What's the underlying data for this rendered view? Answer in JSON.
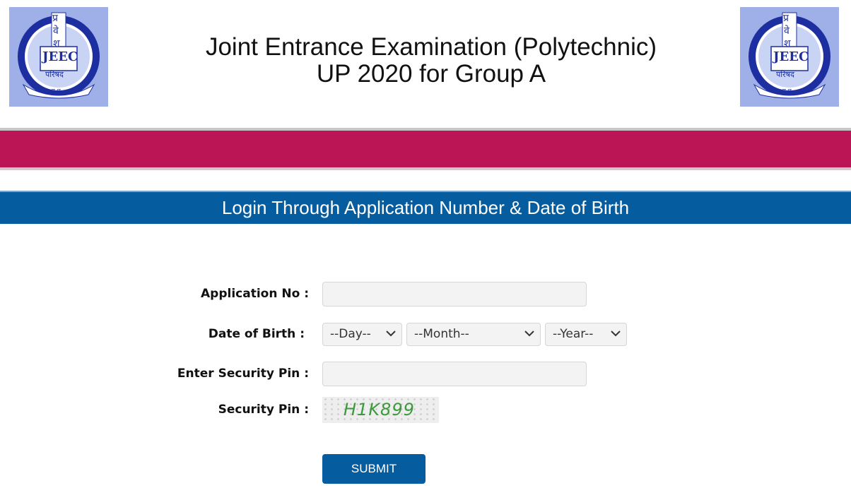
{
  "header": {
    "title_line1": "Joint Entrance Examination (Polytechnic)",
    "title_line2": "UP 2020 for Group A",
    "logo_text": "JEEC",
    "logo_hindi_top": "प्र",
    "logo_hindi_mid": "वे",
    "logo_hindi_bot": "श",
    "logo_hindi_parishad": "परिषद",
    "logo_hindi_up": "उ.प्र.",
    "colors": {
      "accent_band": "#bc1556",
      "bar": "#055d9f"
    }
  },
  "login": {
    "title": "Login Through Application Number & Date of Birth"
  },
  "form": {
    "application_label": "Application No :",
    "application_value": "",
    "dob_label": "Date of Birth :",
    "day_value": "--Day--",
    "month_value": "--Month--",
    "year_value": "--Year--",
    "enter_pin_label": "Enter Security Pin :",
    "enter_pin_value": "",
    "security_pin_label": "Security Pin :",
    "security_pin_captcha": "H1K899",
    "submit_label": "SUBMIT"
  }
}
